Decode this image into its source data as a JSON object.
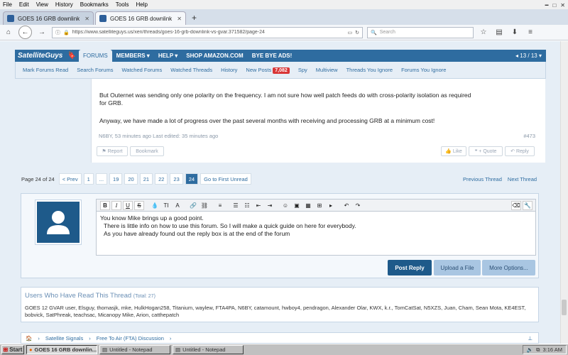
{
  "menubar": {
    "items": [
      "File",
      "Edit",
      "View",
      "History",
      "Bookmarks",
      "Tools",
      "Help"
    ]
  },
  "tabs": [
    {
      "title": "GOES 16 GRB downlink vs GV..."
    },
    {
      "title": "GOES 16 GRB downlink vs GV..."
    }
  ],
  "browser": {
    "url": "https://www.satelliteguys.us/xen/threads/goes-16-grb-downlink-vs-gvar.371582/page-24",
    "search_placeholder": "Search"
  },
  "site": {
    "logo": "SatelliteGuys",
    "nav": [
      "FORUMS",
      "MEMBERS ▾",
      "HELP ▾",
      "SHOP AMAZON.COM",
      "BYE BYE ADS!"
    ],
    "page_count": "◂ 13 / 13 ▾",
    "subnav": [
      "Mark Forums Read",
      "Search Forums",
      "Watched Forums",
      "Watched Threads",
      "History",
      "New Posts",
      "Spy",
      "Multiview",
      "Threads You Ignore",
      "Forums You Ignore"
    ],
    "new_posts_count": "7,082"
  },
  "post": {
    "p1a": "But Outernet was sending only one polarity on the frequency. I am not sure how well patch feeds do with cross-polarity isolation as required",
    "p1b": "for GRB.",
    "p2": "Anyway, we have made a lot of progress over the past several months with receiving and processing GRB at a minimum cost!",
    "meta": "N6BY, 53 minutes ago   Last edited: 35 minutes ago",
    "post_id": "#473",
    "buttons": {
      "report": "⚑ Report",
      "bookmark": "Bookmark",
      "like": "👍 Like",
      "quote": "❝ + Quote",
      "reply": "↶ Reply"
    }
  },
  "pagination": {
    "label": "Page 24 of 24",
    "prev": "< Prev",
    "pages": [
      "1",
      "...",
      "19",
      "20",
      "21",
      "22",
      "23",
      "24"
    ],
    "first_unread": "Go to First Unread",
    "prev_thread": "Previous Thread",
    "next_thread": "Next Thread"
  },
  "editor": {
    "line1": "You know Mike brings up a good point.",
    "line2": "There is little info on how to use this forum. So I will make a quick guide on here for everybody.",
    "line3": "As you have already found out the reply box is at the end of the forum",
    "post_reply": "Post Reply",
    "upload": "Upload a File",
    "more_options": "More Options..."
  },
  "readers": {
    "title": "Users Who Have Read This Thread",
    "total": "(Total: 27)",
    "list": "GOES 12 GVAR user, Elsguy, thomasjk, mke, HulkHogan258, Titanium, waylew, FTA4PA, N6BY, catamount, hwboy4, pendragon, Alexander Olar, KWX, k.r., TomCatSat, N5XZS, Juan, Cham, Sean Mota, KE4EST, bobvick, SatPhreak, teachsac, Micanopy Mike, Arion, catthepatch"
  },
  "breadcrumb": [
    "Satellite Signals",
    "Free To Air (FTA) Discussion"
  ],
  "taskbar": {
    "start": "Start",
    "tasks": [
      "GOES 16 GRB downlin...",
      "Untitled - Notepad",
      "Untitled - Notepad"
    ],
    "time": "3:16 AM"
  }
}
